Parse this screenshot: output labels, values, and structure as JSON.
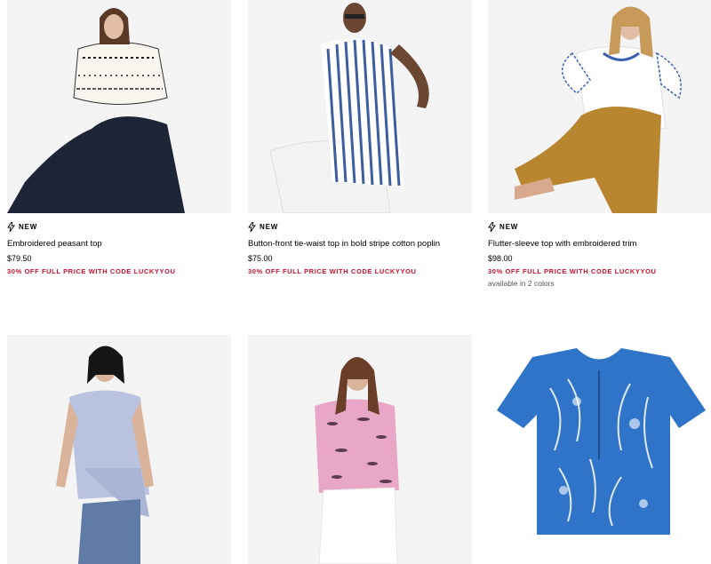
{
  "products": [
    {
      "flag": "NEW",
      "title": "Embroidered peasant top",
      "price": "$79.50",
      "promo": "30% OFF FULL PRICE WITH CODE LUCKYYOU"
    },
    {
      "flag": "NEW",
      "title": "Button-front tie-waist top in bold stripe cotton poplin",
      "price": "$75.00",
      "promo": "30% OFF FULL PRICE WITH CODE LUCKYYOU"
    },
    {
      "flag": "NEW",
      "title": "Flutter-sleeve top with embroidered trim",
      "price": "$98.00",
      "promo": "30% OFF FULL PRICE WITH CODE LUCKYYOU",
      "colors": "available in 2 colors"
    }
  ],
  "colors": {
    "promo": "#c8102e",
    "photo_bg": "#f3f3f3"
  },
  "icons": {
    "flag": "lightning-bolt-icon"
  }
}
